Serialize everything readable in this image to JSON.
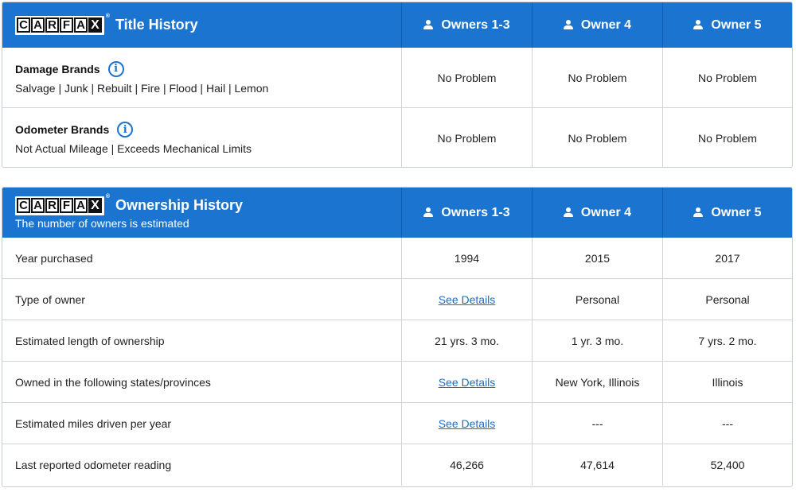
{
  "title_history": {
    "title": "Title History",
    "columns": [
      "Owners 1-3",
      "Owner 4",
      "Owner 5"
    ],
    "rows": [
      {
        "name": "Damage Brands",
        "desc": "Salvage | Junk | Rebuilt | Fire | Flood | Hail | Lemon",
        "values": [
          "No Problem",
          "No Problem",
          "No Problem"
        ]
      },
      {
        "name": "Odometer Brands",
        "desc": "Not Actual Mileage | Exceeds Mechanical Limits",
        "values": [
          "No Problem",
          "No Problem",
          "No Problem"
        ]
      }
    ]
  },
  "ownership_history": {
    "title": "Ownership History",
    "subtitle": "The number of owners is estimated",
    "columns": [
      "Owners 1-3",
      "Owner 4",
      "Owner 5"
    ],
    "rows": [
      {
        "label": "Year purchased",
        "values": [
          "1994",
          "2015",
          "2017"
        ]
      },
      {
        "label": "Type of owner",
        "values": [
          "See Details",
          "Personal",
          "Personal"
        ]
      },
      {
        "label": "Estimated length of ownership",
        "values": [
          "21 yrs. 3 mo.",
          "1 yr. 3 mo.",
          "7 yrs. 2 mo."
        ]
      },
      {
        "label": "Owned in the following states/provinces",
        "values": [
          "See Details",
          "New York, Illinois",
          "Illinois"
        ]
      },
      {
        "label": "Estimated miles driven per year",
        "values": [
          "See Details",
          "---",
          "---"
        ]
      },
      {
        "label": "Last reported odometer reading",
        "values": [
          "46,266",
          "47,614",
          "52,400"
        ]
      }
    ]
  },
  "logo": {
    "letters": [
      "C",
      "A",
      "R",
      "F",
      "A",
      "X"
    ],
    "reg": "®"
  },
  "icons": {
    "person": "person-icon",
    "info": "info-icon",
    "info_glyph": "i"
  },
  "colors": {
    "header_blue": "#1a74d0",
    "link_blue": "#1a6ec9"
  }
}
